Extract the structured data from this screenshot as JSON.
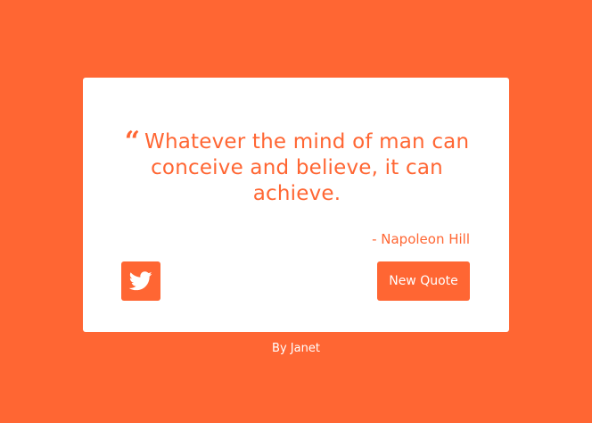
{
  "quote": {
    "mark": "“",
    "text": "Whatever the mind of man can conceive and believe, it can achieve.",
    "author": "- Napoleon Hill"
  },
  "buttons": {
    "tweet_icon": "twitter-icon",
    "new_quote_label": "New Quote"
  },
  "footer": {
    "credit": "By Janet"
  },
  "colors": {
    "accent": "#FF6633",
    "card": "#FFFFFF"
  }
}
